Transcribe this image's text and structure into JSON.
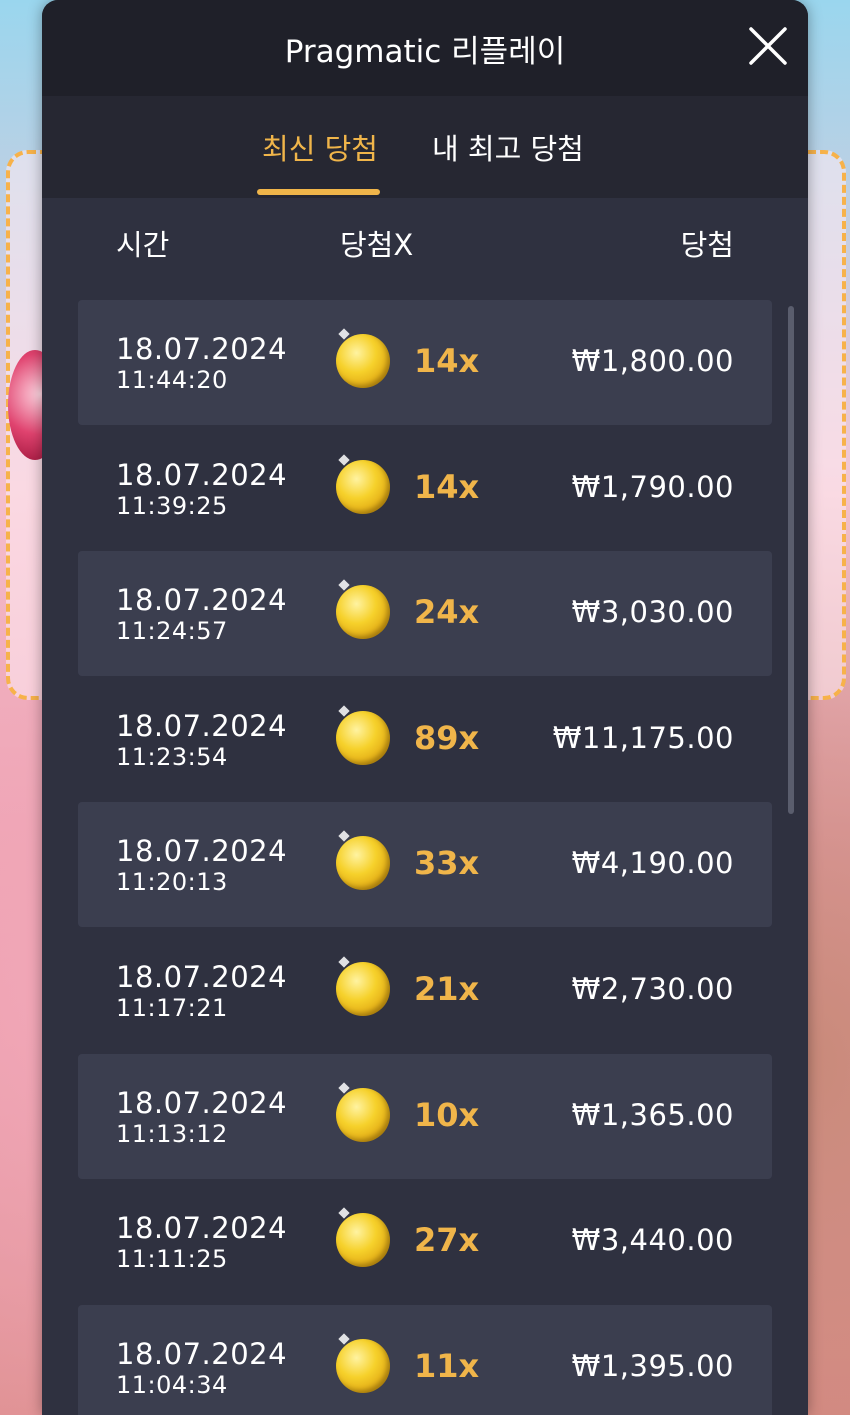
{
  "dialog": {
    "title": "Pragmatic 리플레이",
    "close_icon": "close-icon"
  },
  "tabs": [
    {
      "label": "최신 당첨",
      "active": true
    },
    {
      "label": "내 최고 당첨",
      "active": false
    }
  ],
  "columns": {
    "time": "시간",
    "multiplier": "당첨X",
    "win": "당첨"
  },
  "rows": [
    {
      "date": "18.07.2024",
      "time": "11:44:20",
      "icon": "coin-icon",
      "multiplier": "14x",
      "win": "₩1,800.00"
    },
    {
      "date": "18.07.2024",
      "time": "11:39:25",
      "icon": "coin-icon",
      "multiplier": "14x",
      "win": "₩1,790.00"
    },
    {
      "date": "18.07.2024",
      "time": "11:24:57",
      "icon": "coin-icon",
      "multiplier": "24x",
      "win": "₩3,030.00"
    },
    {
      "date": "18.07.2024",
      "time": "11:23:54",
      "icon": "coin-icon",
      "multiplier": "89x",
      "win": "₩11,175.00"
    },
    {
      "date": "18.07.2024",
      "time": "11:20:13",
      "icon": "coin-icon",
      "multiplier": "33x",
      "win": "₩4,190.00"
    },
    {
      "date": "18.07.2024",
      "time": "11:17:21",
      "icon": "coin-icon",
      "multiplier": "21x",
      "win": "₩2,730.00"
    },
    {
      "date": "18.07.2024",
      "time": "11:13:12",
      "icon": "coin-icon",
      "multiplier": "10x",
      "win": "₩1,365.00"
    },
    {
      "date": "18.07.2024",
      "time": "11:11:25",
      "icon": "coin-icon",
      "multiplier": "27x",
      "win": "₩3,440.00"
    },
    {
      "date": "18.07.2024",
      "time": "11:04:34",
      "icon": "coin-icon",
      "multiplier": "11x",
      "win": "₩1,395.00"
    }
  ],
  "colors": {
    "accent": "#f0b54a",
    "panel": "#2f3140",
    "header": "#1f2029",
    "row_shaded": "#3b3e4f"
  }
}
